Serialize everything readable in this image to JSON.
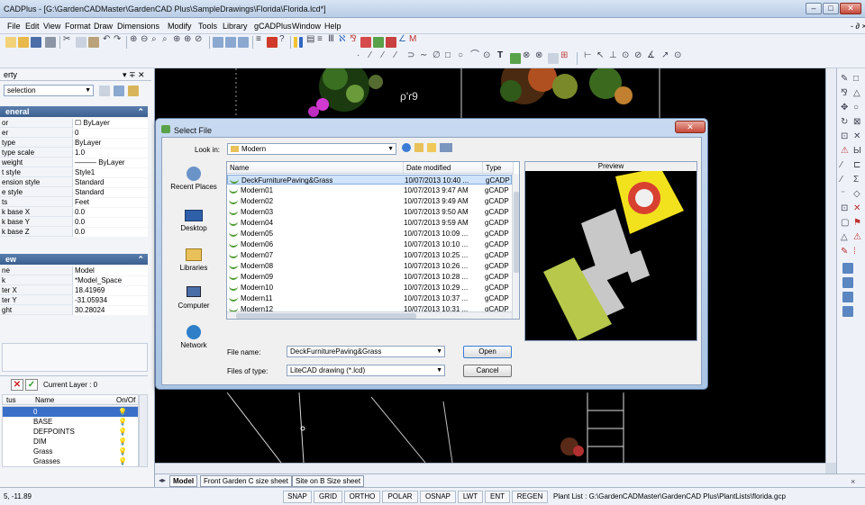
{
  "window": {
    "title": "CADPlus - [G:\\GardenCADMaster\\GardenCAD Plus\\SampleDrawings\\Florida\\Florida.lcd*]"
  },
  "menu": [
    "File",
    "Edit",
    "View",
    "Format",
    "Draw",
    "Dimensions",
    "Modify",
    "Tools",
    "Library",
    "gCADPlus",
    "Window",
    "Help"
  ],
  "left_panel": {
    "title": "erty",
    "selection": "selection",
    "general_header": "eneral",
    "general_rows": [
      {
        "k": "or",
        "v": "☐ ByLayer"
      },
      {
        "k": "er",
        "v": "0"
      },
      {
        "k": "type",
        "v": "ByLayer"
      },
      {
        "k": "type scale",
        "v": "1.0"
      },
      {
        "k": "weight",
        "v": "——— ByLayer"
      },
      {
        "k": "t style",
        "v": "Style1"
      },
      {
        "k": "ension style",
        "v": "Standard"
      },
      {
        "k": "e style",
        "v": "Standard"
      },
      {
        "k": "ts",
        "v": "Feet"
      },
      {
        "k": "k base X",
        "v": "0.0"
      },
      {
        "k": "k base Y",
        "v": "0.0"
      },
      {
        "k": "k base Z",
        "v": "0.0"
      }
    ],
    "view_header": "ew",
    "view_rows": [
      {
        "k": "ne",
        "v": "Model"
      },
      {
        "k": "k",
        "v": "*Model_Space"
      },
      {
        "k": "ter X",
        "v": "18.41969"
      },
      {
        "k": "ter Y",
        "v": "-31.05934"
      },
      {
        "k": "ght",
        "v": "30.28024"
      }
    ],
    "current_layer": "Current Layer : 0",
    "layer_cols": [
      "tus",
      "Name",
      "On/Of"
    ],
    "layers": [
      "0",
      "BASE",
      "DEFPOINTS",
      "DIM",
      "Grass",
      "Grasses"
    ]
  },
  "dialog": {
    "title": "Select File",
    "look_in_label": "Look in:",
    "look_in_value": "Modern",
    "places": [
      "Recent Places",
      "Desktop",
      "Libraries",
      "Computer",
      "Network"
    ],
    "columns": [
      "Name",
      "Date modified",
      "Type"
    ],
    "files": [
      {
        "name": "DeckFurniturePaving&Grass",
        "date": "10/07/2013 10:40 ...",
        "type": "gCADP"
      },
      {
        "name": "Modern01",
        "date": "10/07/2013 9:47 AM",
        "type": "gCADP"
      },
      {
        "name": "Modern02",
        "date": "10/07/2013 9:49 AM",
        "type": "gCADP"
      },
      {
        "name": "Modern03",
        "date": "10/07/2013 9:50 AM",
        "type": "gCADP"
      },
      {
        "name": "Modern04",
        "date": "10/07/2013 9:59 AM",
        "type": "gCADP"
      },
      {
        "name": "Modern05",
        "date": "10/07/2013 10:09 ...",
        "type": "gCADP"
      },
      {
        "name": "Modern06",
        "date": "10/07/2013 10:10 ...",
        "type": "gCADP"
      },
      {
        "name": "Modern07",
        "date": "10/07/2013 10:25 ...",
        "type": "gCADP"
      },
      {
        "name": "Modern08",
        "date": "10/07/2013 10:26 ...",
        "type": "gCADP"
      },
      {
        "name": "Modern09",
        "date": "10/07/2013 10:28 ...",
        "type": "gCADP"
      },
      {
        "name": "Modern10",
        "date": "10/07/2013 10:29 ...",
        "type": "gCADP"
      },
      {
        "name": "Modern11",
        "date": "10/07/2013 10:37 ...",
        "type": "gCADP"
      },
      {
        "name": "Modern12",
        "date": "10/07/2013 10:31 ...",
        "type": "gCADP"
      }
    ],
    "preview_label": "Preview",
    "file_name_label": "File name:",
    "file_name_value": "DeckFurniturePaving&Grass",
    "file_type_label": "Files of type:",
    "file_type_value": "LiteCAD drawing (*.lcd)",
    "open_label": "Open",
    "cancel_label": "Cancel",
    "selected_index": 0
  },
  "canvas": {
    "annotation": "ρ'ɾ9"
  },
  "tabs": [
    "Model",
    "Front Garden C size sheet",
    "Site on B Size sheet"
  ],
  "status": {
    "coords": "5, -11.89",
    "buttons": [
      "SNAP",
      "GRID",
      "ORTHO",
      "POLAR",
      "OSNAP",
      "LWT",
      "ENT",
      "REGEN"
    ],
    "plant_list": "Plant List : G:\\GardenCADMaster\\GardenCAD Plus\\PlantLists\\florida.gcp"
  },
  "colors": {
    "accent": "#3b5f8e",
    "selected_row": "#cfe3fb",
    "canvas_bg": "#000000",
    "grass": "#b8c84a"
  }
}
